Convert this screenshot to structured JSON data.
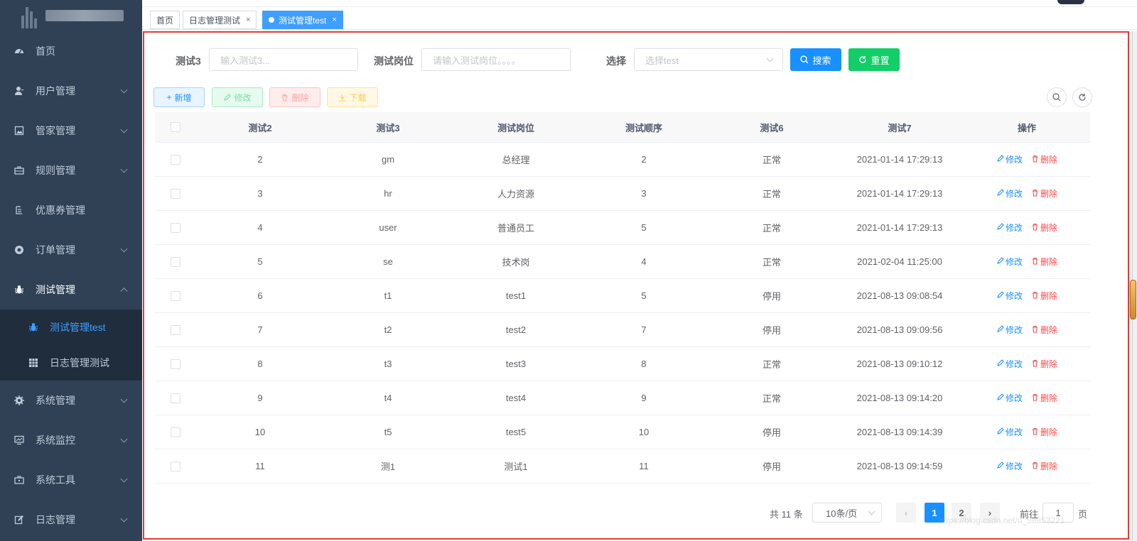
{
  "sidebar": {
    "items": [
      {
        "label": "首页",
        "icon": "dashboard-icon",
        "has_arrow": false
      },
      {
        "label": "用户管理",
        "icon": "user-icon",
        "has_arrow": true
      },
      {
        "label": "管家管理",
        "icon": "picture-icon",
        "has_arrow": true
      },
      {
        "label": "规则管理",
        "icon": "briefcase-icon",
        "has_arrow": true
      },
      {
        "label": "优惠券管理",
        "icon": "list-icon",
        "has_arrow": false
      },
      {
        "label": "订单管理",
        "icon": "lifebuoy-icon",
        "has_arrow": true
      },
      {
        "label": "测试管理",
        "icon": "bug-icon",
        "has_arrow": true,
        "open": true
      },
      {
        "label": "系统管理",
        "icon": "gear-icon",
        "has_arrow": true
      },
      {
        "label": "系统监控",
        "icon": "monitor-icon",
        "has_arrow": true
      },
      {
        "label": "系统工具",
        "icon": "toolbox-icon",
        "has_arrow": true
      },
      {
        "label": "日志管理",
        "icon": "edit-icon",
        "has_arrow": true
      }
    ],
    "subitems": [
      {
        "label": "测试管理test",
        "icon": "bug-icon",
        "active": true
      },
      {
        "label": "日志管理测试",
        "icon": "table-icon",
        "active": false
      }
    ]
  },
  "tags": [
    {
      "label": "首页",
      "closable": false,
      "active": false
    },
    {
      "label": "日志管理测试",
      "closable": true,
      "active": false
    },
    {
      "label": "测试管理test",
      "closable": true,
      "active": true
    }
  ],
  "tag_close": "×",
  "search": {
    "f1_label": "测试3",
    "f1_placeholder": "输入测试3...",
    "f2_label": "测试岗位",
    "f2_placeholder": "请输入测试岗位。。。。",
    "f3_label": "选择",
    "f3_placeholder": "选择test",
    "search_btn": "搜索",
    "reset_btn": "重置"
  },
  "toolbar": {
    "add": "新增",
    "edit": "修改",
    "delete": "删除",
    "download": "下载"
  },
  "table": {
    "columns": [
      "测试2",
      "测试3",
      "测试岗位",
      "测试顺序",
      "测试6",
      "测试7",
      "操作"
    ],
    "rows": [
      [
        "2",
        "gm",
        "总经理",
        "2",
        "正常",
        "2021-01-14 17:29:13"
      ],
      [
        "3",
        "hr",
        "人力资源",
        "3",
        "正常",
        "2021-01-14 17:29:13"
      ],
      [
        "4",
        "user",
        "普通员工",
        "5",
        "正常",
        "2021-01-14 17:29:13"
      ],
      [
        "5",
        "se",
        "技术岗",
        "4",
        "正常",
        "2021-02-04 11:25:00"
      ],
      [
        "6",
        "t1",
        "test1",
        "5",
        "停用",
        "2021-08-13 09:08:54"
      ],
      [
        "7",
        "t2",
        "test2",
        "7",
        "停用",
        "2021-08-13 09:09:56"
      ],
      [
        "8",
        "t3",
        "test3",
        "8",
        "正常",
        "2021-08-13 09:10:12"
      ],
      [
        "9",
        "t4",
        "test4",
        "9",
        "正常",
        "2021-08-13 09:14:20"
      ],
      [
        "10",
        "t5",
        "test5",
        "10",
        "停用",
        "2021-08-13 09:14:39"
      ],
      [
        "11",
        "测1",
        "测试1",
        "11",
        "停用",
        "2021-08-13 09:14:59"
      ]
    ],
    "op_edit": "修改",
    "op_delete": "删除"
  },
  "pagination": {
    "total": "共 11 条",
    "page_size": "10条/页",
    "pages": [
      "1",
      "2"
    ],
    "current": "1",
    "goto_label": "前往",
    "goto_value": "1",
    "page_suffix": "页"
  },
  "watermark": "https://blog.csdn.net/u_58853221",
  "colors": {
    "primary": "#1890ff",
    "success": "#13ce66",
    "danger": "#ff4949",
    "sidebar_bg": "#304156",
    "frame": "#e53935"
  }
}
